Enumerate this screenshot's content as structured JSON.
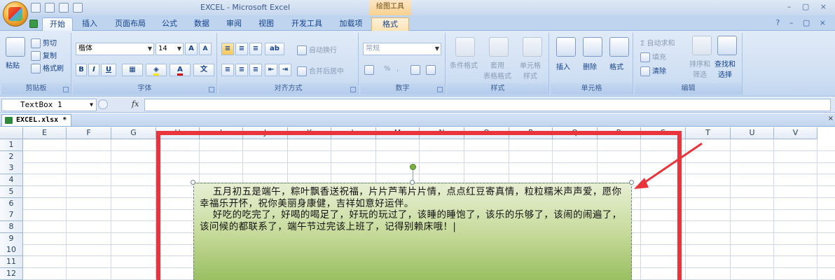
{
  "title_bar": {
    "window_title": "EXCEL - Microsoft Excel",
    "context_tab_group": "绘图工具",
    "window_controls": "– ▢ ×"
  },
  "ribbon_tabs": [
    {
      "label": "开始",
      "active": true
    },
    {
      "label": "插入"
    },
    {
      "label": "页面布局"
    },
    {
      "label": "公式"
    },
    {
      "label": "数据"
    },
    {
      "label": "审阅"
    },
    {
      "label": "视图"
    },
    {
      "label": "开发工具"
    },
    {
      "label": "加载项"
    },
    {
      "label": "格式",
      "contextual": true
    }
  ],
  "ribbon": {
    "clipboard": {
      "paste": "粘贴",
      "cut": "剪切",
      "copy": "复制",
      "format_painter": "格式刷",
      "label": "剪贴板"
    },
    "font": {
      "font_name": "楷体",
      "font_size": "14",
      "grow": "A",
      "shrink": "A",
      "bold": "B",
      "italic": "I",
      "underline": "U",
      "label": "字体"
    },
    "alignment": {
      "wrap_text": "自动换行",
      "merge_center": "合并后居中",
      "label": "对齐方式"
    },
    "number": {
      "format": "常规",
      "percent": "%",
      "comma": ",",
      "label": "数字"
    },
    "styles": {
      "conditional": "条件格式",
      "table_format": "套用\n表格格式",
      "cell_styles": "单元格\n样式",
      "label": "样式"
    },
    "cells": {
      "insert": "插入",
      "delete": "删除",
      "format": "格式",
      "label": "单元格"
    },
    "editing": {
      "autosum": "Σ 自动求和",
      "fill": "填充",
      "clear": "清除",
      "sort_filter": "排序和\n筛选",
      "find_select": "查找和\n选择",
      "label": "编辑"
    }
  },
  "formula_bar": {
    "name_box": "TextBox 1",
    "fx": "fx",
    "value": ""
  },
  "workbook_tab": {
    "label": "EXCEL.xlsx *"
  },
  "columns": [
    "E",
    "F",
    "G",
    "H",
    "I",
    "J",
    "K",
    "L",
    "M",
    "N",
    "O",
    "P",
    "Q",
    "R",
    "S",
    "T",
    "U",
    "V"
  ],
  "rows": [
    "1",
    "2",
    "3",
    "4",
    "5",
    "6",
    "7",
    "8",
    "9",
    "10",
    "11",
    "12"
  ],
  "textbox": {
    "text": "    五月初五是端午，粽叶飘香送祝福，片片芦苇片片情，点点红豆寄真情，粒粒糯米声声爱，愿你幸福乐开怀，祝你美丽身康健，吉祥如意好运伴。\n    好吃的吃完了，好喝的喝足了，好玩的玩过了，该睡的睡饱了，该乐的乐够了，该闹的闹遍了，该问候的都联系了，端午节过完该上班了，记得别赖床哦！|"
  },
  "colors": {
    "highlight": "#e8343a",
    "textbox_top": "#e7efd4",
    "textbox_bottom": "#93bb5a"
  }
}
